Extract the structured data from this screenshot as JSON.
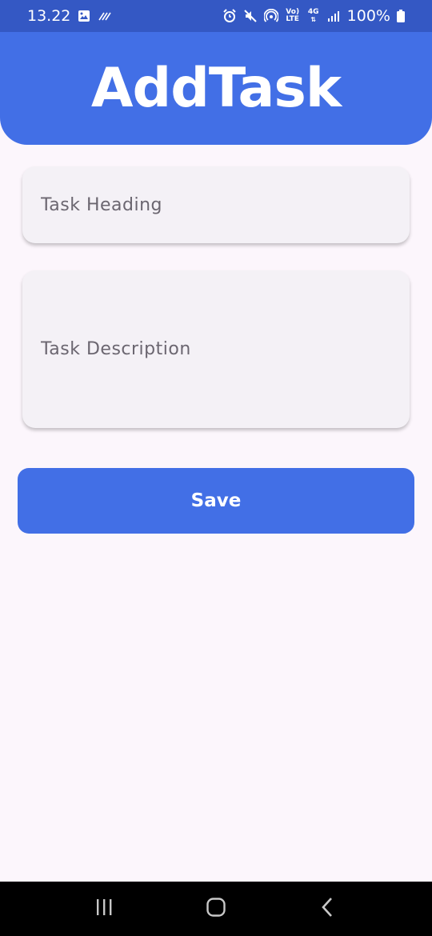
{
  "status_bar": {
    "time": "13.22",
    "battery": "100%",
    "volte_top": "Vo)",
    "volte_bottom": "LTE",
    "network": "4G"
  },
  "header": {
    "title": "AddTask"
  },
  "form": {
    "heading_placeholder": "Task Heading",
    "description_placeholder": "Task Description",
    "save_label": "Save"
  },
  "colors": {
    "primary": "#426fe6",
    "status_bar": "#3458c4",
    "background": "#fcf6fc",
    "field_bg": "#f4f1f6"
  },
  "icons": {
    "status_left": [
      "gallery-icon",
      "data-saver-icon"
    ],
    "status_right": [
      "alarm-icon",
      "mute-icon",
      "hotspot-icon",
      "volte-icon",
      "signal-icon",
      "battery-icon"
    ],
    "nav": [
      "recents-icon",
      "home-icon",
      "back-icon"
    ]
  }
}
